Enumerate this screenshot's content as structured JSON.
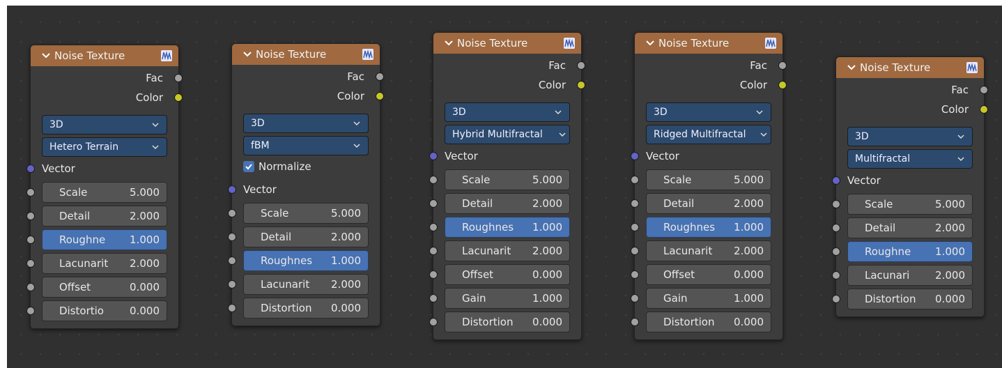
{
  "colors": {
    "header": "#a0693f",
    "body": "#3c3c3c",
    "canvas": "#303030",
    "dropdown": "#2c4a6d",
    "field": "#545454",
    "field_active": "#4772b3",
    "socket_grey": "#a1a1a1",
    "socket_yellow": "#c7c729",
    "socket_blue": "#6363c7"
  },
  "icons": {
    "collapse": "chevron-down-icon",
    "preview": "texture-preview-icon",
    "dropdown": "chevron-down-icon",
    "checkbox": "checkmark-icon"
  },
  "nodes": [
    {
      "title": "Noise Texture",
      "outputs": [
        "Fac",
        "Color"
      ],
      "dimension": "3D",
      "type": "Hetero Terrain",
      "vector_label": "Vector",
      "fields": [
        {
          "label": "Scale",
          "value": "5.000"
        },
        {
          "label": "Detail",
          "value": "2.000"
        },
        {
          "label": "Roughne",
          "value": "1.000"
        },
        {
          "label": "Lacunarit",
          "value": "2.000"
        },
        {
          "label": "Offset",
          "value": "0.000"
        },
        {
          "label": "Distortio",
          "value": "0.000"
        }
      ]
    },
    {
      "title": "Noise Texture",
      "outputs": [
        "Fac",
        "Color"
      ],
      "dimension": "3D",
      "type": "fBM",
      "normalize_label": "Normalize",
      "normalize_checked": true,
      "vector_label": "Vector",
      "fields": [
        {
          "label": "Scale",
          "value": "5.000"
        },
        {
          "label": "Detail",
          "value": "2.000"
        },
        {
          "label": "Roughnes",
          "value": "1.000"
        },
        {
          "label": "Lacunarit",
          "value": "2.000"
        },
        {
          "label": "Distortion",
          "value": "0.000"
        }
      ]
    },
    {
      "title": "Noise Texture",
      "outputs": [
        "Fac",
        "Color"
      ],
      "dimension": "3D",
      "type": "Hybrid Multifractal",
      "vector_label": "Vector",
      "fields": [
        {
          "label": "Scale",
          "value": "5.000"
        },
        {
          "label": "Detail",
          "value": "2.000"
        },
        {
          "label": "Roughnes",
          "value": "1.000"
        },
        {
          "label": "Lacunarit",
          "value": "2.000"
        },
        {
          "label": "Offset",
          "value": "0.000"
        },
        {
          "label": "Gain",
          "value": "1.000"
        },
        {
          "label": "Distortion",
          "value": "0.000"
        }
      ]
    },
    {
      "title": "Noise Texture",
      "outputs": [
        "Fac",
        "Color"
      ],
      "dimension": "3D",
      "type": "Ridged Multifractal",
      "vector_label": "Vector",
      "fields": [
        {
          "label": "Scale",
          "value": "5.000"
        },
        {
          "label": "Detail",
          "value": "2.000"
        },
        {
          "label": "Roughnes",
          "value": "1.000"
        },
        {
          "label": "Lacunarit",
          "value": "2.000"
        },
        {
          "label": "Offset",
          "value": "0.000"
        },
        {
          "label": "Gain",
          "value": "1.000"
        },
        {
          "label": "Distortion",
          "value": "0.000"
        }
      ]
    },
    {
      "title": "Noise Texture",
      "outputs": [
        "Fac",
        "Color"
      ],
      "dimension": "3D",
      "type": "Multifractal",
      "vector_label": "Vector",
      "fields": [
        {
          "label": "Scale",
          "value": "5.000"
        },
        {
          "label": "Detail",
          "value": "2.000"
        },
        {
          "label": "Roughne",
          "value": "1.000"
        },
        {
          "label": "Lacunari",
          "value": "2.000"
        },
        {
          "label": "Distortion",
          "value": "0.000"
        }
      ]
    }
  ]
}
